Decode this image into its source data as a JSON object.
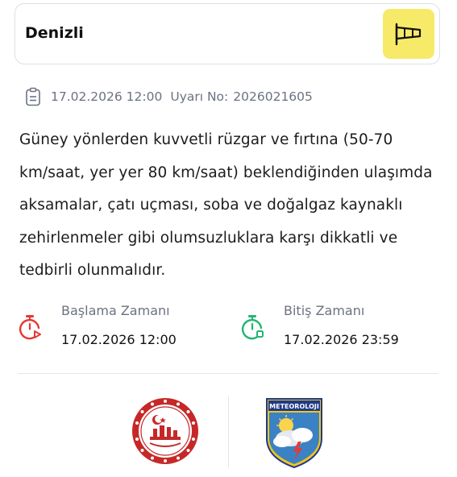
{
  "header": {
    "city": "Denizli",
    "wind_icon": "windsock-icon",
    "wind_button_color": "#f6ea68"
  },
  "meta": {
    "icon": "clipboard-icon",
    "datetime": "17.02.2026 12:00",
    "warning_no_label": "Uyarı No:",
    "warning_no": "2026021605"
  },
  "description": "Güney yönlerden kuvvetli rüzgar ve fırtına (50-70 km/saat, yer yer 80 km/saat) beklendiğinden ulaşımda aksamalar, çatı uçması, soba ve doğalgaz kaynaklı zehirlenmeler gibi olumsuzluklara karşı dikkatli ve tedbirli olunmalıdır.",
  "times": {
    "start": {
      "label": "Başlama Zamanı",
      "value": "17.02.2026 12:00",
      "icon": "timer-start-icon",
      "color": "#e53935"
    },
    "end": {
      "label": "Bitiş Zamanı",
      "value": "17.02.2026 23:59",
      "icon": "timer-stop-icon",
      "color": "#22b573"
    }
  },
  "logos": {
    "left": {
      "icon": "ministry-emblem-logo",
      "color": "#c62828"
    },
    "right": {
      "icon": "meteoroloji-logo",
      "text": "METEOROLOJI",
      "color": "#f5c518"
    }
  }
}
